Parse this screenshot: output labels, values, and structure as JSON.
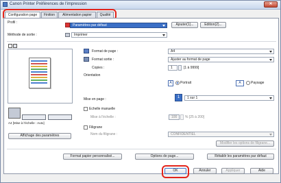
{
  "window": {
    "title": "Canon Printer Préférences de l'impression",
    "close_glyph": "✕"
  },
  "tabs": [
    {
      "label": "Configuration page"
    },
    {
      "label": "Finition"
    },
    {
      "label": "Alimentation papier"
    },
    {
      "label": "Qualité"
    }
  ],
  "profile": {
    "label": "Profil :",
    "value": "Paramètres par défaut",
    "add_label": "Ajouter(1)...",
    "edit_label": "Edition(2)..."
  },
  "output_method": {
    "label": "Méthode de sortie :",
    "value": "Imprimer"
  },
  "preview": {
    "caption": "A4 [Mise à l'échelle : Auto]",
    "view_settings_label": "Affichage des paramètres"
  },
  "page_size": {
    "label": "Format de page :",
    "value": "A4"
  },
  "output_size": {
    "label": "Format sortie :",
    "value": "Ajuster au format de page"
  },
  "copies": {
    "label": "Copies :",
    "value": "1",
    "range": "[1 à 9999]"
  },
  "orientation": {
    "label": "Orientation",
    "portrait_label": "Portrait",
    "landscape_label": "Paysage"
  },
  "page_layout": {
    "label": "Mise en page :",
    "value": "1 sur 1"
  },
  "manual_scaling": {
    "label": "Echelle manuelle",
    "scaling_label": "Mise à l'échelle :",
    "scaling_value": "100",
    "scaling_range": "% [25 à 200]"
  },
  "watermark": {
    "label": "Filigrane",
    "name_label": "Nom du filigrane :",
    "name_value": "CONFIDENTIEL",
    "edit_label": "Modifier les options de filigrane..."
  },
  "bottom_buttons": {
    "custom_size": "Format papier personnalisé...",
    "page_options": "Options de page...",
    "restore_defaults": "Rétablir les paramètres par défaut"
  },
  "dialog_buttons": {
    "ok": "OK",
    "cancel": "Annuler",
    "apply": "Appliquer",
    "help": "Aide"
  }
}
